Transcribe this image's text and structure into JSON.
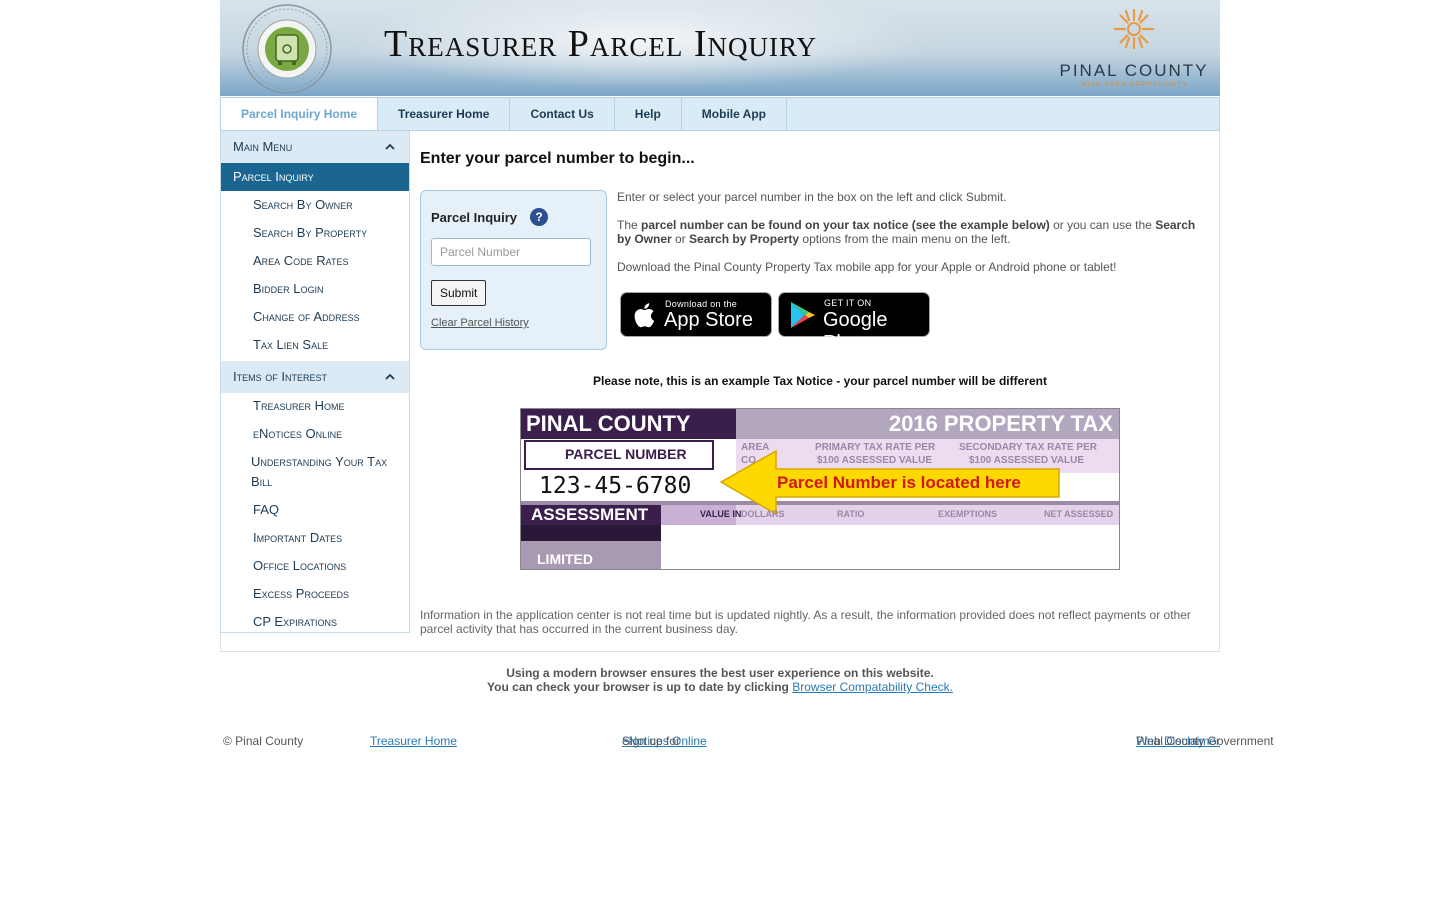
{
  "banner": {
    "title": "Treasurer Parcel Inquiry",
    "seal_text": "TREASURER · PINAL COUNTY ARIZONA",
    "seal_inner": "PINAL",
    "county_name": "PINAL COUNTY",
    "county_tagline": "WIDE OPEN OPPORTUNITY",
    "accent_color": "#f0a24a"
  },
  "nav": {
    "items": [
      {
        "label": "Parcel Inquiry Home",
        "active": true
      },
      {
        "label": "Treasurer Home"
      },
      {
        "label": "Contact Us"
      },
      {
        "label": "Help"
      },
      {
        "label": "Mobile App"
      }
    ]
  },
  "sidebar": {
    "main_menu": {
      "title": "Main Menu",
      "active": "Parcel Inquiry",
      "items": [
        "Search By Owner",
        "Search By Property",
        "Area Code Rates",
        "Bidder Login",
        "Change of Address",
        "Tax Lien Sale"
      ]
    },
    "items_of_interest": {
      "title": "Items of Interest",
      "items": [
        "Treasurer Home",
        "eNotices Online",
        "Understanding Your Tax Bill",
        "FAQ",
        "Important Dates",
        "Office Locations",
        "Excess Proceeds",
        "CP Expirations"
      ]
    }
  },
  "main": {
    "heading": "Enter your parcel number to begin...",
    "inquiry": {
      "title": "Parcel Inquiry",
      "help": "?",
      "placeholder": "Parcel Number",
      "submit": "Submit",
      "clear": "Clear Parcel History"
    },
    "info": {
      "p1": "Enter or select your parcel number in the box on the left and click Submit.",
      "p2_pre": "The ",
      "p2_bold1": "parcel number can be found on your tax notice (see the example below)",
      "p2_mid": " or you can use the ",
      "p2_bold2": "Search by Owner",
      "p2_or": " or ",
      "p2_bold3": "Search by Property",
      "p2_post": " options from the main menu on the left.",
      "p3": "Download the Pinal County Property Tax mobile app for your Apple or Android phone or tablet!"
    },
    "app_store": {
      "small": "Download on the",
      "big": "App Store"
    },
    "google_play": {
      "small": "GET IT ON",
      "big": "Google Play"
    },
    "note": "Please note, this is an example Tax Notice - your parcel number will be different",
    "sample": {
      "county": "PINAL COUNTY",
      "year_title": "2016 PROPERTY TAX",
      "parcel_label": "PARCEL NUMBER",
      "area_code": "AREA",
      "code2": "CO",
      "primary": "PRIMARY TAX RATE PER",
      "primary2": "$100 ASSESSED VALUE",
      "secondary": "SECONDARY TAX RATE PER",
      "secondary2": "$100 ASSESSED VALUE",
      "parcel_number": "123-45-6780",
      "callout": "Parcel Number is located here",
      "assessment": "ASSESSMENT",
      "value_in": "VALUE IN",
      "dollars": "DOLLARS",
      "ratio": "RATIO",
      "exemptions": "EXEMPTIONS",
      "net": "NET ASSESSED",
      "limited": "LIMITED"
    },
    "disclaimer": "Information in the application center is not real time but is updated nightly. As a result, the information provided does not reflect payments or other parcel activity that has occurred in the current business day."
  },
  "browser": {
    "line1": "Using a modern browser ensures the best user experience on this website.",
    "line2": "You can check your browser is up to date by clicking ",
    "link": "Browser Compatability Check."
  },
  "footer": {
    "copyright": "© Pinal County",
    "treasurer": "Treasurer Home",
    "signup_pre": "Sign up for ",
    "signup_link": "eNotices Online",
    "gov": "Pinal County Government ",
    "disclaimer_link": "Web Disclaimer"
  }
}
